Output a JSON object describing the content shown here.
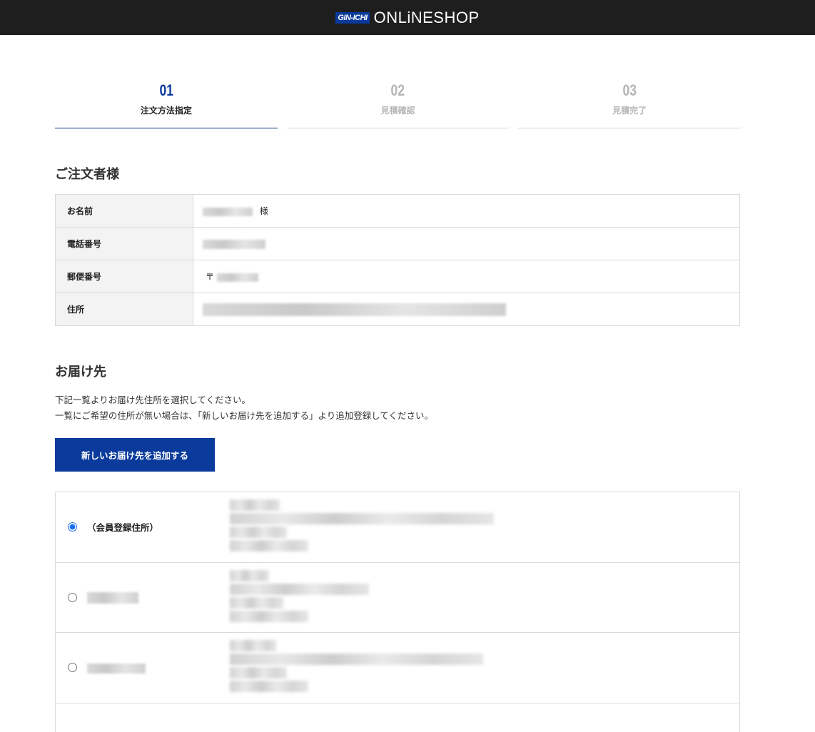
{
  "header": {
    "logo_badge": "GIN-ICHI",
    "logo_text": "ONLiNESHOP"
  },
  "steps": [
    {
      "num": "01",
      "label": "注文方法指定",
      "active": true
    },
    {
      "num": "02",
      "label": "見積確認",
      "active": false
    },
    {
      "num": "03",
      "label": "見積完了",
      "active": false
    }
  ],
  "orderer": {
    "title": "ご注文者様",
    "rows": [
      {
        "label": "お名前",
        "suffix": "様"
      },
      {
        "label": "電話番号",
        "suffix": ""
      },
      {
        "label": "郵便番号",
        "prefix": "〒"
      },
      {
        "label": "住所",
        "suffix": ""
      }
    ]
  },
  "delivery": {
    "title": "お届け先",
    "desc_line1": "下記一覧よりお届け先住所を選択してください。",
    "desc_line2": "一覧にご希望の住所が無い場合は、「新しいお届け先を追加する」より追加登録してください。",
    "add_button": "新しいお届け先を追加する",
    "addresses": [
      {
        "label": "（会員登録住所）",
        "selected": true
      },
      {
        "label": "",
        "selected": false
      },
      {
        "label": "",
        "selected": false
      }
    ]
  },
  "colors": {
    "accent": "#0a3a9c",
    "header_bg": "#1e1e1e"
  }
}
